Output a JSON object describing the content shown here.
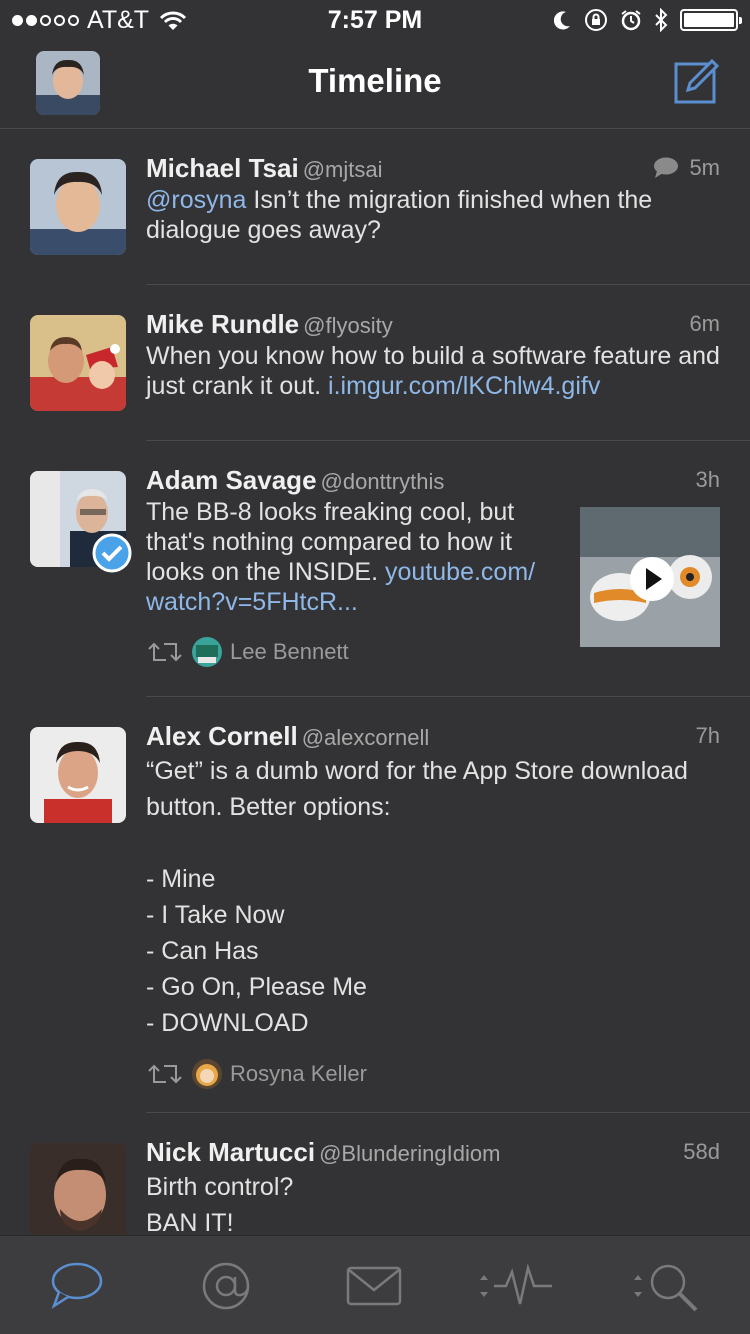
{
  "status_bar": {
    "carrier": "AT&T",
    "time": "7:57 PM",
    "signal_bars": 2,
    "battery_level": 1.0
  },
  "nav": {
    "title": "Timeline",
    "compose_icon": "compose-icon",
    "accent": "#5b8fd0"
  },
  "tweets": [
    {
      "name": "Michael Tsai",
      "handle": "@mjtsai",
      "time": "5m",
      "has_reply_icon": true,
      "mention": "@rosyna",
      "text": " Isn’t the migration finished when the dialogue goes away?"
    },
    {
      "name": "Mike Rundle",
      "handle": "@flyosity",
      "time": "6m",
      "text": "When you know how to build a software feature and just crank it out. ",
      "link": "i.imgur.com/lKChlw4.gifv"
    },
    {
      "name": "Adam Savage",
      "handle": "@donttrythis",
      "time": "3h",
      "verified": true,
      "text": "The BB-8 looks freaking cool, but that's nothing compared to how it looks on the INSIDE. ",
      "link": "youtube.com/ watch?v=5FHtcR...",
      "retweeted_by": "Lee Bennett"
    },
    {
      "name": "Alex Cornell",
      "handle": "@alexcornell",
      "time": "7h",
      "lines": [
        "“Get” is a dumb word for the App Store download",
        "button. Better options:",
        "",
        "- Mine",
        "- I Take Now",
        "- Can Has",
        "- Go On, Please Me",
        "- DOWNLOAD"
      ],
      "retweeted_by": "Rosyna Keller"
    },
    {
      "name": "Nick Martucci",
      "handle": "@BlunderingIdiom",
      "time": "58d",
      "lines": [
        "Birth control?",
        "BAN IT!"
      ]
    }
  ],
  "tab_bar": {
    "tabs": [
      "timeline-tab",
      "mentions-tab",
      "messages-tab",
      "activity-tab",
      "search-tab"
    ],
    "active": "timeline-tab"
  }
}
